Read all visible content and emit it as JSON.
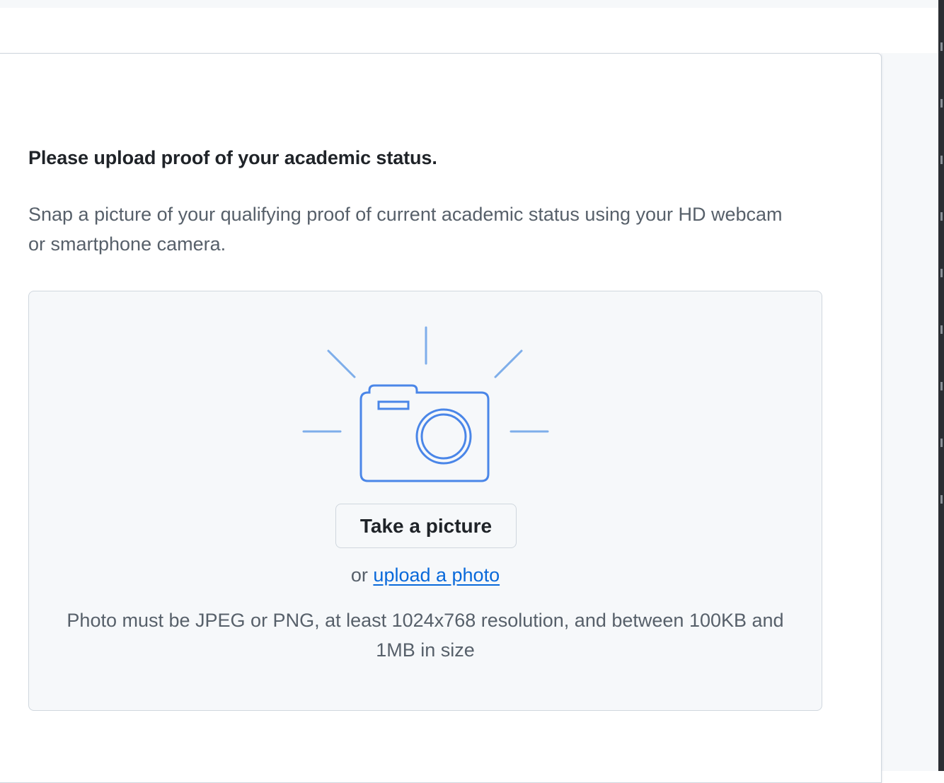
{
  "heading": "Please upload proof of your academic status.",
  "description": "Snap a picture of your qualifying proof of current academic status using your HD webcam or smartphone camera.",
  "dropzone": {
    "illustration_icon": "camera-icon",
    "take_picture_label": "Take a picture",
    "or_text": "or ",
    "upload_link_label": "upload a photo",
    "requirements": "Photo must be JPEG or PNG, at least 1024x768 resolution, and between 100KB and 1MB in size"
  },
  "colors": {
    "accent": "#0969da",
    "icon_blue": "#4a86e8",
    "text_primary": "#1f2328",
    "text_muted": "#57606a",
    "surface_muted": "#f6f8fa",
    "border": "#d0d7de"
  }
}
